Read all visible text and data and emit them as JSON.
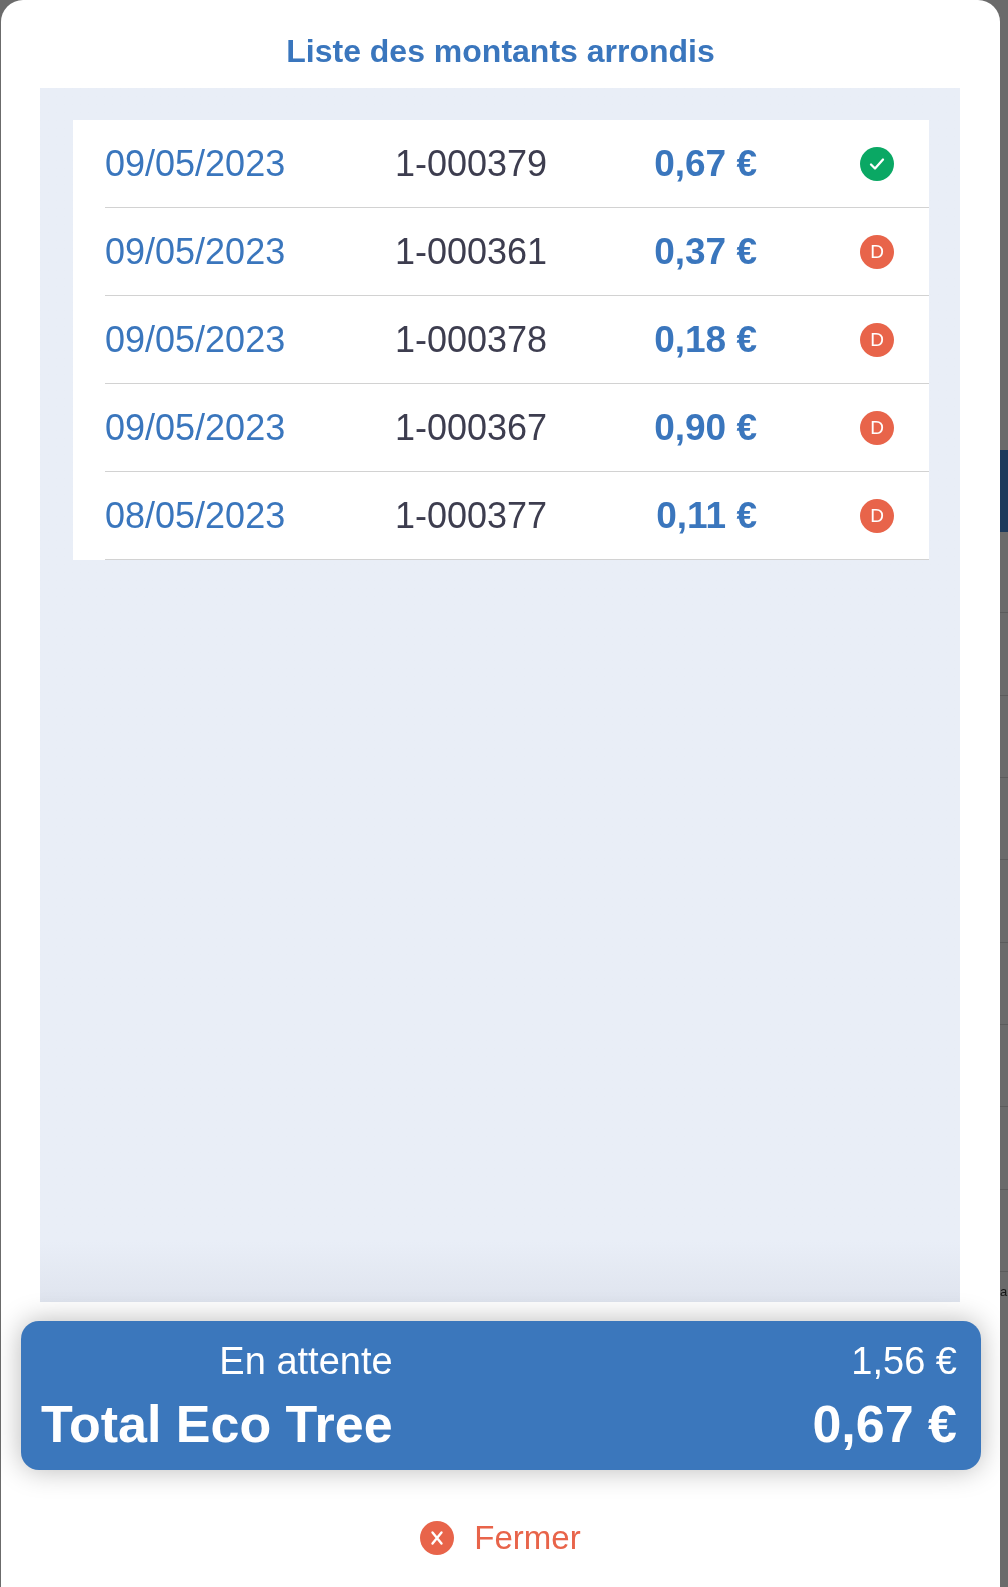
{
  "dialog": {
    "title": "Liste des montants arrondis"
  },
  "rows": [
    {
      "date": "09/05/2023",
      "number": "1-000379",
      "amount": "0,67 €",
      "status": {
        "kind": "check",
        "color": "#0aa864"
      }
    },
    {
      "date": "09/05/2023",
      "number": "1-000361",
      "amount": "0,37 €",
      "status": {
        "kind": "letter",
        "letter": "D",
        "color": "#e8644a"
      }
    },
    {
      "date": "09/05/2023",
      "number": "1-000378",
      "amount": "0,18 €",
      "status": {
        "kind": "letter",
        "letter": "D",
        "color": "#e8644a"
      }
    },
    {
      "date": "09/05/2023",
      "number": "1-000367",
      "amount": "0,90 €",
      "status": {
        "kind": "letter",
        "letter": "D",
        "color": "#e8644a"
      }
    },
    {
      "date": "08/05/2023",
      "number": "1-000377",
      "amount": "0,11 €",
      "status": {
        "kind": "letter",
        "letter": "D",
        "color": "#e8644a"
      }
    }
  ],
  "summary": [
    {
      "kind": "subtotal",
      "label": "En attente",
      "value": "1,56 €"
    },
    {
      "kind": "total",
      "label": "Total Eco Tree",
      "value": "0,67 €"
    }
  ],
  "close_button": {
    "label": "Fermer"
  },
  "background": {
    "text": "a"
  }
}
